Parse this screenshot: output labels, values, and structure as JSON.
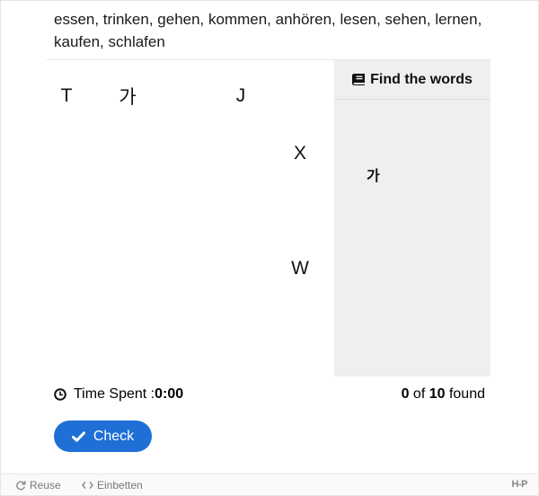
{
  "task_text": "essen, trinken, gehen, kommen, anhören, lesen, sehen, lernen, kaufen, schlafen",
  "grid": [
    [
      "T",
      "가",
      "",
      "J",
      ""
    ],
    [
      "",
      "",
      "",
      "",
      "X"
    ],
    [
      "",
      "",
      "",
      "",
      ""
    ],
    [
      "",
      "",
      "",
      "",
      "W"
    ],
    [
      "",
      "",
      "",
      "",
      ""
    ]
  ],
  "panel": {
    "title": "Find the words",
    "title_icon": "book-icon",
    "words": [
      "",
      "",
      "가",
      "",
      "",
      "",
      "",
      "",
      "",
      ""
    ]
  },
  "status": {
    "time_label": "Time Spent : ",
    "time_value": "0:00",
    "found_count": "0",
    "found_of": " of ",
    "found_total": "10",
    "found_suffix": " found"
  },
  "check_button": {
    "label": "Check",
    "color": "#1f6fd6"
  },
  "footer": {
    "reuse_label": "Reuse",
    "embed_label": "Einbetten",
    "logo_text": "H-P"
  }
}
